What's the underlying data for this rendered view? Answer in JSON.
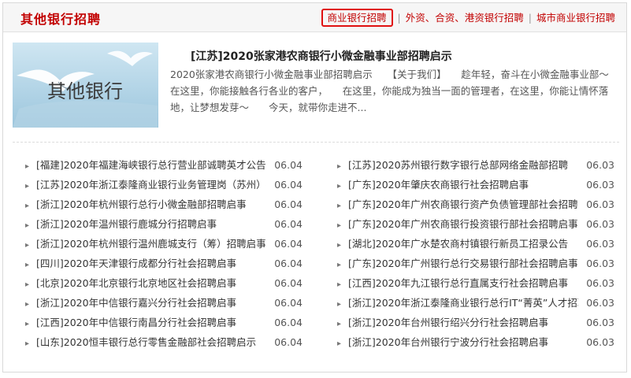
{
  "header": {
    "title": "其他银行招聘",
    "tabs": [
      {
        "label": "商业银行招聘",
        "active": true
      },
      {
        "label": "外资、合资、港资银行招聘",
        "active": false
      },
      {
        "label": "城市商业银行招聘",
        "active": false
      }
    ],
    "tab_separator": "|"
  },
  "feature": {
    "image_text": "其他银行",
    "title": "[江苏]2020张家港农商银行小微金融事业部招聘启示",
    "description": "2020张家港农商银行小微金融事业部招聘启示　　【关于我们】　　趁年轻，奋斗在小微金融事业部～　　在这里，你能接触各行各业的客户，　　在这里，你能成为独当一面的管理者，在这里，你能让情怀落地，让梦想发芽～　　今天，就带你走进不..."
  },
  "news": {
    "bullet": "▸",
    "left": [
      {
        "title": "[福建]2020年福建海峡银行总行营业部诚聘英才公告",
        "date": "06.04"
      },
      {
        "title": "[江苏]2020年浙江泰隆商业银行业务管理岗（苏州）招聘",
        "date": "06.04"
      },
      {
        "title": "[浙江]2020年杭州银行总行小微金融部招聘启事",
        "date": "06.04"
      },
      {
        "title": "[浙江]2020年温州银行鹿城分行招聘启事",
        "date": "06.04"
      },
      {
        "title": "[浙江]2020年杭州银行温州鹿城支行（筹）招聘启事",
        "date": "06.04"
      },
      {
        "title": "[四川]2020年天津银行成都分行社会招聘启事",
        "date": "06.04"
      },
      {
        "title": "[北京]2020年北京银行北京地区社会招聘启事",
        "date": "06.04"
      },
      {
        "title": "[浙江]2020年中信银行嘉兴分行社会招聘启事",
        "date": "06.04"
      },
      {
        "title": "[江西]2020年中信银行南昌分行社会招聘启事",
        "date": "06.04"
      },
      {
        "title": "[山东]2020恒丰银行总行零售金融部社会招聘启示",
        "date": "06.04"
      }
    ],
    "right": [
      {
        "title": "[江苏]2020苏州银行数字银行总部网络金融部招聘",
        "date": "06.03"
      },
      {
        "title": "[广东]2020年肇庆农商银行社会招聘启事",
        "date": "06.03"
      },
      {
        "title": "[广东]2020年广州农商银行资产负债管理部社会招聘",
        "date": "06.03"
      },
      {
        "title": "[广东]2020年广州农商银行投资银行部社会招聘启事",
        "date": "06.03"
      },
      {
        "title": "[湖北]2020年广水楚农商村镇银行新员工招录公告",
        "date": "06.03"
      },
      {
        "title": "[广东]2020年广州银行总行交易银行部社会招聘启事",
        "date": "06.03"
      },
      {
        "title": "[江西]2020年九江银行总行直属支行社会招聘启事",
        "date": "06.03"
      },
      {
        "title": "[浙江]2020年浙江泰隆商业银行总行IT“菁英”人才招聘",
        "date": "06.03"
      },
      {
        "title": "[浙江]2020年台州银行绍兴分行社会招聘启事",
        "date": "06.03"
      },
      {
        "title": "[浙江]2020年台州银行宁波分行社会招聘启事",
        "date": "06.03"
      }
    ]
  }
}
